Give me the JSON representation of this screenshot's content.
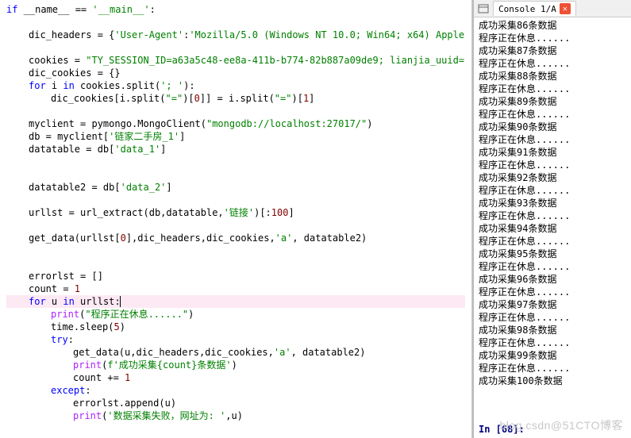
{
  "editor": {
    "lines": [
      {
        "t": "if",
        "c": "kw"
      },
      {
        "t": " __name__ == ",
        "c": "name"
      },
      {
        "t": "'__main__'",
        "c": "str"
      },
      {
        "t": ":",
        "c": "op"
      },
      {
        "br": 1
      },
      {
        "br": 1
      },
      {
        "ind": 1
      },
      {
        "t": "dic_headers = {",
        "c": "name"
      },
      {
        "t": "'User-Agent'",
        "c": "str"
      },
      {
        "t": ":",
        "c": "op"
      },
      {
        "t": "'Mozilla/5.0 (Windows NT 10.0; Win64; x64) Apple",
        "c": "str"
      },
      {
        "br": 1
      },
      {
        "br": 1
      },
      {
        "ind": 1
      },
      {
        "t": "cookies = ",
        "c": "name"
      },
      {
        "t": "\"TY_SESSION_ID=a63a5c48-ee8a-411b-b774-82b887a09de9; lianjia_uuid=",
        "c": "str"
      },
      {
        "br": 1
      },
      {
        "ind": 1
      },
      {
        "t": "dic_cookies = {}",
        "c": "name"
      },
      {
        "br": 1
      },
      {
        "ind": 1
      },
      {
        "t": "for",
        "c": "kw"
      },
      {
        "t": " i ",
        "c": "name"
      },
      {
        "t": "in",
        "c": "kw"
      },
      {
        "t": " cookies.split(",
        "c": "name"
      },
      {
        "t": "'; '",
        "c": "str"
      },
      {
        "t": "):",
        "c": "name"
      },
      {
        "br": 1
      },
      {
        "ind": 2
      },
      {
        "t": "dic_cookies[i.split(",
        "c": "name"
      },
      {
        "t": "\"=\"",
        "c": "str"
      },
      {
        "t": ")[",
        "c": "name"
      },
      {
        "t": "0",
        "c": "num"
      },
      {
        "t": "]] = i.split(",
        "c": "name"
      },
      {
        "t": "\"=\"",
        "c": "str"
      },
      {
        "t": ")[",
        "c": "name"
      },
      {
        "t": "1",
        "c": "num"
      },
      {
        "t": "]",
        "c": "name"
      },
      {
        "br": 1
      },
      {
        "br": 1
      },
      {
        "ind": 1
      },
      {
        "t": "myclient = pymongo.MongoClient(",
        "c": "name"
      },
      {
        "t": "\"mongodb://localhost:27017/\"",
        "c": "str"
      },
      {
        "t": ")",
        "c": "name"
      },
      {
        "br": 1
      },
      {
        "ind": 1
      },
      {
        "t": "db = myclient[",
        "c": "name"
      },
      {
        "t": "'链家二手房_1'",
        "c": "str"
      },
      {
        "t": "]",
        "c": "name"
      },
      {
        "br": 1
      },
      {
        "ind": 1
      },
      {
        "t": "datatable = db[",
        "c": "name"
      },
      {
        "t": "'data_1'",
        "c": "str"
      },
      {
        "t": "]",
        "c": "name"
      },
      {
        "br": 1
      },
      {
        "br": 1
      },
      {
        "br": 1
      },
      {
        "ind": 1
      },
      {
        "t": "datatable2 = db[",
        "c": "name"
      },
      {
        "t": "'data_2'",
        "c": "str"
      },
      {
        "t": "]",
        "c": "name"
      },
      {
        "br": 1
      },
      {
        "br": 1
      },
      {
        "ind": 1
      },
      {
        "t": "urllst = url_extract(db,datatable,",
        "c": "name"
      },
      {
        "t": "'链接'",
        "c": "str"
      },
      {
        "t": ")[:",
        "c": "name"
      },
      {
        "t": "100",
        "c": "num"
      },
      {
        "t": "]",
        "c": "name"
      },
      {
        "br": 1
      },
      {
        "br": 1
      },
      {
        "ind": 1
      },
      {
        "t": "get_data(urllst[",
        "c": "name"
      },
      {
        "t": "0",
        "c": "num"
      },
      {
        "t": "],dic_headers,dic_cookies,",
        "c": "name"
      },
      {
        "t": "'a'",
        "c": "str"
      },
      {
        "t": ", datatable2)",
        "c": "name"
      },
      {
        "br": 1
      },
      {
        "br": 1
      },
      {
        "br": 1
      },
      {
        "ind": 1
      },
      {
        "t": "errorlst = []",
        "c": "name"
      },
      {
        "br": 1
      },
      {
        "ind": 1
      },
      {
        "t": "count = ",
        "c": "name"
      },
      {
        "t": "1",
        "c": "num"
      },
      {
        "br": 1
      },
      {
        "hl": 1
      },
      {
        "ind": 1
      },
      {
        "t": "for",
        "c": "kw"
      },
      {
        "t": " u ",
        "c": "name"
      },
      {
        "t": "in",
        "c": "kw"
      },
      {
        "t": " urllst:",
        "c": "name"
      },
      {
        "caret": 1
      },
      {
        "hlend": 1
      },
      {
        "br": 1
      },
      {
        "ind": 2
      },
      {
        "t": "print",
        "c": "purple"
      },
      {
        "t": "(",
        "c": "name"
      },
      {
        "t": "\"程序正在休息......\"",
        "c": "str"
      },
      {
        "t": ")",
        "c": "name"
      },
      {
        "br": 1
      },
      {
        "ind": 2
      },
      {
        "t": "time.sleep(",
        "c": "name"
      },
      {
        "t": "5",
        "c": "num"
      },
      {
        "t": ")",
        "c": "name"
      },
      {
        "br": 1
      },
      {
        "ind": 2
      },
      {
        "t": "try",
        "c": "kw"
      },
      {
        "t": ":",
        "c": "op"
      },
      {
        "br": 1
      },
      {
        "ind": 3
      },
      {
        "t": "get_data(u,dic_headers,dic_cookies,",
        "c": "name"
      },
      {
        "t": "'a'",
        "c": "str"
      },
      {
        "t": ", datatable2)",
        "c": "name"
      },
      {
        "br": 1
      },
      {
        "ind": 3
      },
      {
        "t": "print",
        "c": "purple"
      },
      {
        "t": "(",
        "c": "name"
      },
      {
        "t": "f'成功采集{count}条数据'",
        "c": "str"
      },
      {
        "t": ")",
        "c": "name"
      },
      {
        "br": 1
      },
      {
        "ind": 3
      },
      {
        "t": "count += ",
        "c": "name"
      },
      {
        "t": "1",
        "c": "num"
      },
      {
        "br": 1
      },
      {
        "ind": 2
      },
      {
        "t": "except",
        "c": "kw"
      },
      {
        "t": ":",
        "c": "op"
      },
      {
        "br": 1
      },
      {
        "ind": 3
      },
      {
        "t": "errorlst.append(u)",
        "c": "name"
      },
      {
        "br": 1
      },
      {
        "ind": 3
      },
      {
        "t": "print",
        "c": "purple"
      },
      {
        "t": "(",
        "c": "name"
      },
      {
        "t": "'数据采集失败，网址为: '",
        "c": "str"
      },
      {
        "t": ",u)",
        "c": "name"
      },
      {
        "br": 1
      }
    ]
  },
  "console": {
    "tab_label": "Console 1/A",
    "output": [
      "成功采集86条数据",
      "程序正在休息......",
      "成功采集87条数据",
      "程序正在休息......",
      "成功采集88条数据",
      "程序正在休息......",
      "成功采集89条数据",
      "程序正在休息......",
      "成功采集90条数据",
      "程序正在休息......",
      "成功采集91条数据",
      "程序正在休息......",
      "成功采集92条数据",
      "程序正在休息......",
      "成功采集93条数据",
      "程序正在休息......",
      "成功采集94条数据",
      "程序正在休息......",
      "成功采集95条数据",
      "程序正在休息......",
      "成功采集96条数据",
      "程序正在休息......",
      "成功采集97条数据",
      "程序正在休息......",
      "成功采集98条数据",
      "程序正在休息......",
      "成功采集99条数据",
      "程序正在休息......",
      "成功采集100条数据"
    ],
    "prompt": "In [68]:"
  },
  "watermark": "blog.csdn@51CTO博客"
}
